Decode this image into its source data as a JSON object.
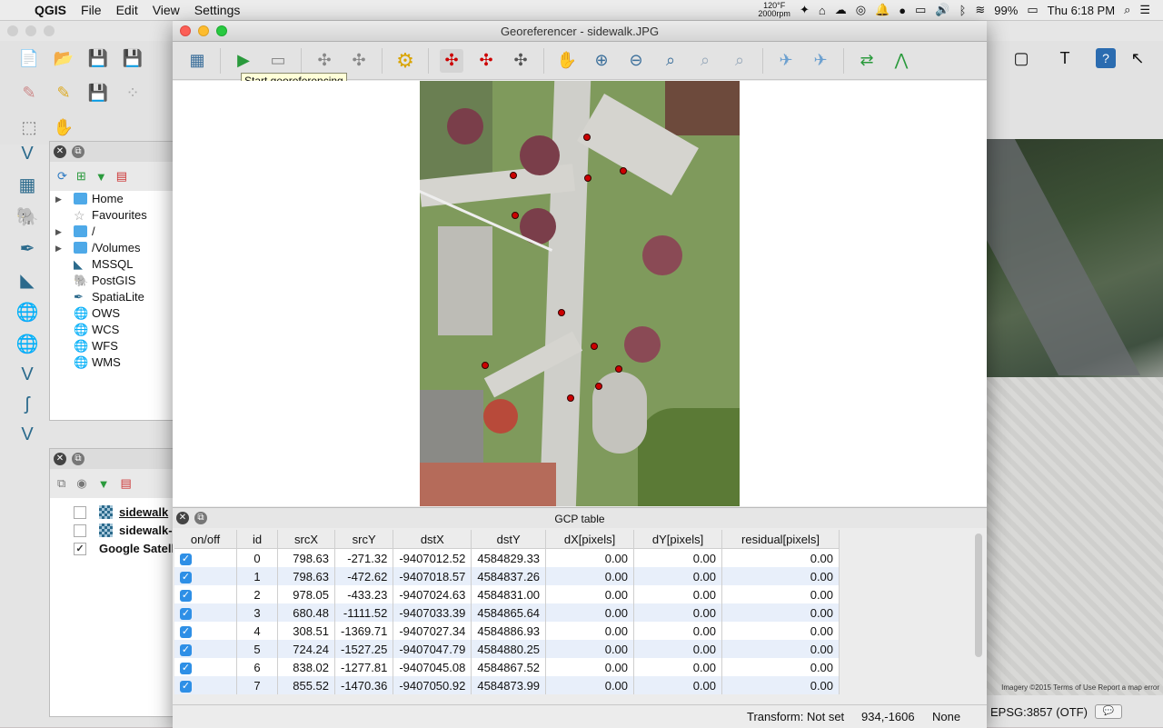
{
  "menubar": {
    "app_name": "QGIS",
    "menus": [
      "File",
      "Edit",
      "View",
      "Settings"
    ],
    "temp": "120°F",
    "rpm": "2000rpm",
    "battery": "99%",
    "clock": "Thu 6:18 PM"
  },
  "georef": {
    "title": "Georeferencer - sidewalk.JPG",
    "tooltip": "Start georeferencing",
    "gcp_table_title": "GCP table",
    "columns": [
      "on/off",
      "id",
      "srcX",
      "srcY",
      "dstX",
      "dstY",
      "dX[pixels]",
      "dY[pixels]",
      "residual[pixels]"
    ],
    "rows": [
      {
        "id": "0",
        "srcX": "798.63",
        "srcY": "-271.32",
        "dstX": "-9407012.52",
        "dstY": "4584829.33",
        "dX": "0.00",
        "dY": "0.00",
        "res": "0.00"
      },
      {
        "id": "1",
        "srcX": "798.63",
        "srcY": "-472.62",
        "dstX": "-9407018.57",
        "dstY": "4584837.26",
        "dX": "0.00",
        "dY": "0.00",
        "res": "0.00"
      },
      {
        "id": "2",
        "srcX": "978.05",
        "srcY": "-433.23",
        "dstX": "-9407024.63",
        "dstY": "4584831.00",
        "dX": "0.00",
        "dY": "0.00",
        "res": "0.00"
      },
      {
        "id": "3",
        "srcX": "680.48",
        "srcY": "-1111.52",
        "dstX": "-9407033.39",
        "dstY": "4584865.64",
        "dX": "0.00",
        "dY": "0.00",
        "res": "0.00"
      },
      {
        "id": "4",
        "srcX": "308.51",
        "srcY": "-1369.71",
        "dstX": "-9407027.34",
        "dstY": "4584886.93",
        "dX": "0.00",
        "dY": "0.00",
        "res": "0.00"
      },
      {
        "id": "5",
        "srcX": "724.24",
        "srcY": "-1527.25",
        "dstX": "-9407047.79",
        "dstY": "4584880.25",
        "dX": "0.00",
        "dY": "0.00",
        "res": "0.00"
      },
      {
        "id": "6",
        "srcX": "838.02",
        "srcY": "-1277.81",
        "dstX": "-9407045.08",
        "dstY": "4584867.52",
        "dX": "0.00",
        "dY": "0.00",
        "res": "0.00"
      },
      {
        "id": "7",
        "srcX": "855.52",
        "srcY": "-1470.36",
        "dstX": "-9407050.92",
        "dstY": "4584873.99",
        "dX": "0.00",
        "dY": "0.00",
        "res": "0.00"
      }
    ],
    "status": {
      "transform": "Transform: Not set",
      "coords": "934,-1606",
      "crs": "None"
    }
  },
  "browser": {
    "items": [
      {
        "label": "Home"
      },
      {
        "label": "Favourites"
      },
      {
        "label": "/"
      },
      {
        "label": "/Volumes"
      },
      {
        "label": "MSSQL"
      },
      {
        "label": "PostGIS"
      },
      {
        "label": "SpatiaLite"
      },
      {
        "label": "OWS"
      },
      {
        "label": "WCS"
      },
      {
        "label": "WFS"
      },
      {
        "label": "WMS"
      }
    ]
  },
  "layers": {
    "items": [
      {
        "label": "sidewalk"
      },
      {
        "label": "sidewalk-"
      },
      {
        "label": "Google Satell"
      }
    ]
  },
  "map": {
    "credit": "Imagery ©2015   Terms of Use   Report a map error"
  },
  "qgis_status": {
    "crs": "EPSG:3857 (OTF)"
  }
}
